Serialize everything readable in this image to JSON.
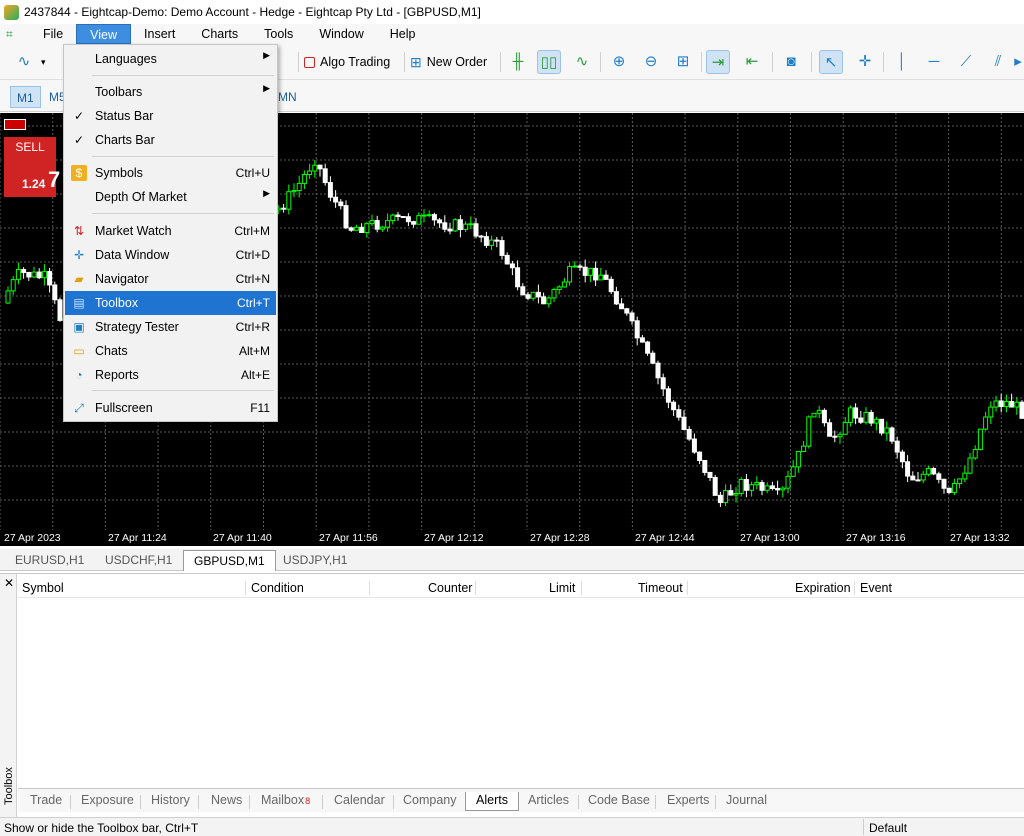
{
  "window": {
    "title": "2437844 - Eightcap-Demo: Demo Account - Hedge - Eightcap Pty Ltd - [GBPUSD,M1]"
  },
  "menubar": {
    "items": [
      "File",
      "View",
      "Insert",
      "Charts",
      "Tools",
      "Window",
      "Help"
    ]
  },
  "toolbar": {
    "algo_label": "Algo Trading",
    "order_label": "New Order"
  },
  "timeframes": {
    "m1": "M1",
    "m5": "M5",
    "mn": "MN"
  },
  "view_menu": {
    "languages": "Languages",
    "toolbars": "Toolbars",
    "status_bar": "Status Bar",
    "charts_bar": "Charts Bar",
    "symbols": "Symbols",
    "symbols_sc": "Ctrl+U",
    "depth": "Depth Of Market",
    "market_watch": "Market Watch",
    "market_watch_sc": "Ctrl+M",
    "data_window": "Data Window",
    "data_window_sc": "Ctrl+D",
    "navigator": "Navigator",
    "navigator_sc": "Ctrl+N",
    "toolbox": "Toolbox",
    "toolbox_sc": "Ctrl+T",
    "strategy": "Strategy Tester",
    "strategy_sc": "Ctrl+R",
    "chats": "Chats",
    "chats_sc": "Alt+M",
    "reports": "Reports",
    "reports_sc": "Alt+E",
    "fullscreen": "Fullscreen",
    "fullscreen_sc": "F11"
  },
  "chart": {
    "sell_label": "SELL",
    "sell_price": "1.24",
    "sell_big": "7",
    "time_labels": [
      "27 Apr 2023",
      "27 Apr 11:24",
      "27 Apr 11:40",
      "27 Apr 11:56",
      "27 Apr 12:12",
      "27 Apr 12:28",
      "27 Apr 12:44",
      "27 Apr 13:00",
      "27 Apr 13:16",
      "27 Apr 13:32"
    ],
    "up_color": "#00ff00",
    "down_color": "#ffffff",
    "grid_color": "#5a5a5a"
  },
  "chart_tabs": [
    "EURUSD,H1",
    "USDCHF,H1",
    "GBPUSD,M1",
    "USDJPY,H1"
  ],
  "toolbox": {
    "vertical_label": "Toolbox",
    "columns": [
      "Symbol",
      "Condition",
      "Counter",
      "Limit",
      "Timeout",
      "Expiration",
      "Event"
    ],
    "tabs": [
      "Trade",
      "Exposure",
      "History",
      "News",
      "Mailbox",
      "Calendar",
      "Company",
      "Alerts",
      "Articles",
      "Code Base",
      "Experts",
      "Journal"
    ],
    "mailbox_badge": "8"
  },
  "status": {
    "left": "Show or hide the Toolbox bar, Ctrl+T",
    "right": "Default"
  }
}
